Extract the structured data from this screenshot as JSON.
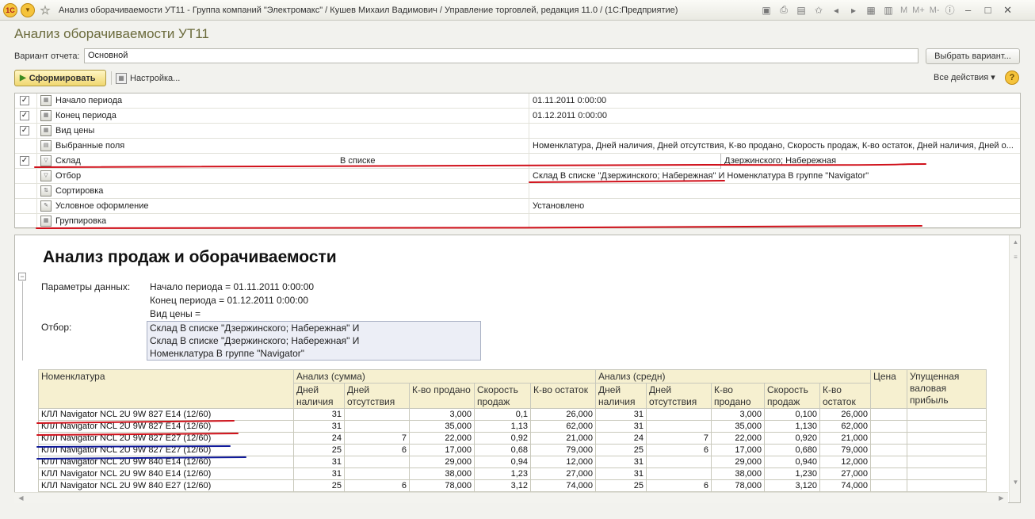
{
  "window": {
    "title": "Анализ оборачиваемости УТ11 - Группа компаний \"Электромакс\" / Кушев Михаил Вадимович / Управление торговлей, редакция 11.0 / (1С:Предприятие)",
    "logo_text": "1С",
    "memory_buttons": [
      "M",
      "M+",
      "M-"
    ]
  },
  "form": {
    "title": "Анализ оборачиваемости УТ11",
    "variant_label": "Вариант отчета:",
    "variant_value": "Основной",
    "choose_variant_label": "Выбрать вариант...",
    "generate_label": "Сформировать",
    "settings_label": "Настройка...",
    "all_actions_label": "Все действия",
    "help_label": "?"
  },
  "settings": [
    {
      "checked": true,
      "name": "Начало периода",
      "condition": "",
      "value": "01.11.2011 0:00:00"
    },
    {
      "checked": true,
      "name": "Конец периода",
      "condition": "",
      "value": "01.12.2011 0:00:00"
    },
    {
      "checked": true,
      "name": "Вид цены",
      "condition": "",
      "value": ""
    },
    {
      "checked": null,
      "name": "Выбранные поля",
      "condition": "",
      "value": "Номенклатура, Дней наличия, Дней отсутствия, К-во продано, Скорость продаж, К-во остаток, Дней наличия, Дней о..."
    },
    {
      "checked": true,
      "name": "Склад",
      "condition": "В списке",
      "value": "",
      "value2": "Дзержинского; Набережная"
    },
    {
      "checked": null,
      "name": "Отбор",
      "condition": "",
      "value": "Склад В списке \"Дзержинского; Набережная\" И Номенклатура В группе \"Navigator\""
    },
    {
      "checked": null,
      "name": "Сортировка",
      "condition": "",
      "value": ""
    },
    {
      "checked": null,
      "name": "Условное оформление",
      "condition": "",
      "value": "Установлено"
    },
    {
      "checked": null,
      "name": "Группировка",
      "condition": "",
      "value": ""
    }
  ],
  "report": {
    "title": "Анализ продаж и оборачиваемости",
    "params_label": "Параметры данных:",
    "params": [
      "Начало периода = 01.11.2011 0:00:00",
      "Конец периода = 01.12.2011 0:00:00",
      "Вид цены ="
    ],
    "filter_label": "Отбор:",
    "filter_lines": [
      "Склад В списке \"Дзержинского; Набережная\" И",
      "Склад В списке \"Дзержинского; Набережная\" И",
      "Номенклатура В группе \"Navigator\""
    ],
    "table": {
      "col_nom": "Номенклатура",
      "group_sum": "Анализ (сумма)",
      "group_avg": "Анализ (средн)",
      "col_price": "Цена",
      "col_profit": "Упущенная валовая прибыль",
      "sub_sum": [
        "Дней наличия",
        "Дней отсутствия",
        "К-во продано",
        "Скорость продаж",
        "К-во остаток"
      ],
      "sub_avg": [
        "Дней наличия",
        "Дней отсутствия",
        "К-во продано",
        "Скорость продаж",
        "К-во остаток"
      ],
      "rows": [
        {
          "nom": "КЛЛ Navigator NCL 2U  9W 827 E14 (12/60)",
          "s": [
            "31",
            "",
            "3,000",
            "0,1",
            "26,000"
          ],
          "a": [
            "31",
            "",
            "3,000",
            "0,100",
            "26,000"
          ]
        },
        {
          "nom": "КЛЛ Navigator NCL 2U  9W 827 E14 (12/60)",
          "s": [
            "31",
            "",
            "35,000",
            "1,13",
            "62,000"
          ],
          "a": [
            "31",
            "",
            "35,000",
            "1,130",
            "62,000"
          ]
        },
        {
          "nom": "КЛЛ Navigator NCL 2U  9W 827 E27 (12/60)",
          "s": [
            "24",
            "7",
            "22,000",
            "0,92",
            "21,000"
          ],
          "a": [
            "24",
            "7",
            "22,000",
            "0,920",
            "21,000"
          ]
        },
        {
          "nom": "КЛЛ Navigator NCL 2U  9W 827 E27 (12/60)",
          "s": [
            "25",
            "6",
            "17,000",
            "0,68",
            "79,000"
          ],
          "a": [
            "25",
            "6",
            "17,000",
            "0,680",
            "79,000"
          ]
        },
        {
          "nom": "КЛЛ Navigator NCL 2U  9W 840 E14 (12/60)",
          "s": [
            "31",
            "",
            "29,000",
            "0,94",
            "12,000"
          ],
          "a": [
            "31",
            "",
            "29,000",
            "0,940",
            "12,000"
          ]
        },
        {
          "nom": "КЛЛ Navigator NCL 2U  9W 840 E14 (12/60)",
          "s": [
            "31",
            "",
            "38,000",
            "1,23",
            "27,000"
          ],
          "a": [
            "31",
            "",
            "38,000",
            "1,230",
            "27,000"
          ]
        },
        {
          "nom": "КЛЛ Navigator NCL 2U  9W 840 E27 (12/60)",
          "s": [
            "25",
            "6",
            "78,000",
            "3,12",
            "74,000"
          ],
          "a": [
            "25",
            "6",
            "78,000",
            "3,120",
            "74,000"
          ]
        }
      ]
    }
  },
  "colors": {
    "accent": "#f0d770",
    "annotation_red": "#d0101a",
    "annotation_blue": "#101a9a",
    "header_bg": "#f6f0d0"
  }
}
